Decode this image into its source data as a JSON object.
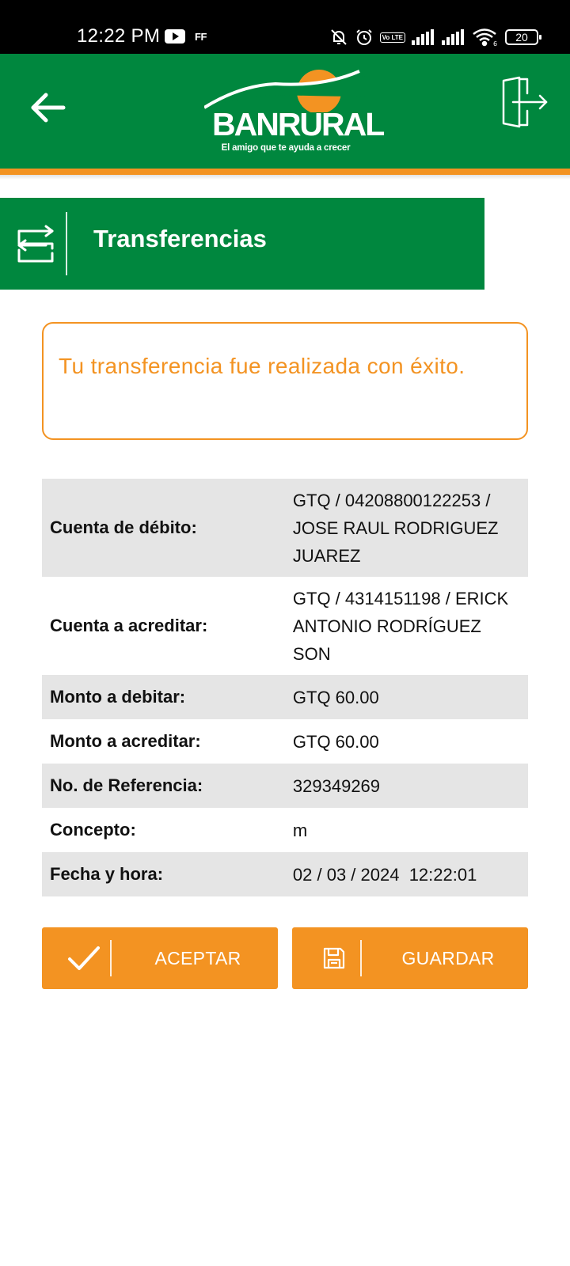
{
  "status_bar": {
    "time": "12:22 PM",
    "left_icons": [
      "youtube-icon",
      "ff-icon"
    ],
    "ff_label": "FF",
    "right_icons": [
      "mute-icon",
      "alarm-icon",
      "volte-icon",
      "signal-icon",
      "signal-icon",
      "wifi-icon",
      "battery-icon"
    ],
    "volte_label": "Vo LTE",
    "wifi_label": "6",
    "battery_level": "20"
  },
  "header": {
    "back_icon": "arrow-left-icon",
    "logo_name": "BANRURAL",
    "logo_tagline": "El amigo que te ayuda a crecer",
    "logout_icon": "logout-icon",
    "colors": {
      "green": "#00873e",
      "orange": "#f39322"
    }
  },
  "section": {
    "icon": "transfer-icon",
    "title": "Transferencias"
  },
  "message": {
    "text": "Tu transferencia fue realizada con éxito."
  },
  "details": [
    {
      "label": "Cuenta de débito:",
      "value": "GTQ / 04208800122253 / JOSE RAUL RODRIGUEZ JUAREZ"
    },
    {
      "label": "Cuenta a acreditar:",
      "value": "GTQ / 4314151198 / ERICK ANTONIO RODRÍGUEZ SON"
    },
    {
      "label": "Monto a debitar:",
      "value": "GTQ 60.00"
    },
    {
      "label": "Monto a acreditar:",
      "value": "GTQ 60.00"
    },
    {
      "label": "No. de Referencia:",
      "value": "329349269"
    },
    {
      "label": "Concepto:",
      "value": "m"
    },
    {
      "label": "Fecha y hora:",
      "value": "02 / 03 / 2024  12:22:01"
    }
  ],
  "buttons": {
    "accept": {
      "label": "ACEPTAR",
      "icon": "checkmark-icon"
    },
    "save": {
      "label": "GUARDAR",
      "icon": "floppy-disk-icon"
    }
  }
}
